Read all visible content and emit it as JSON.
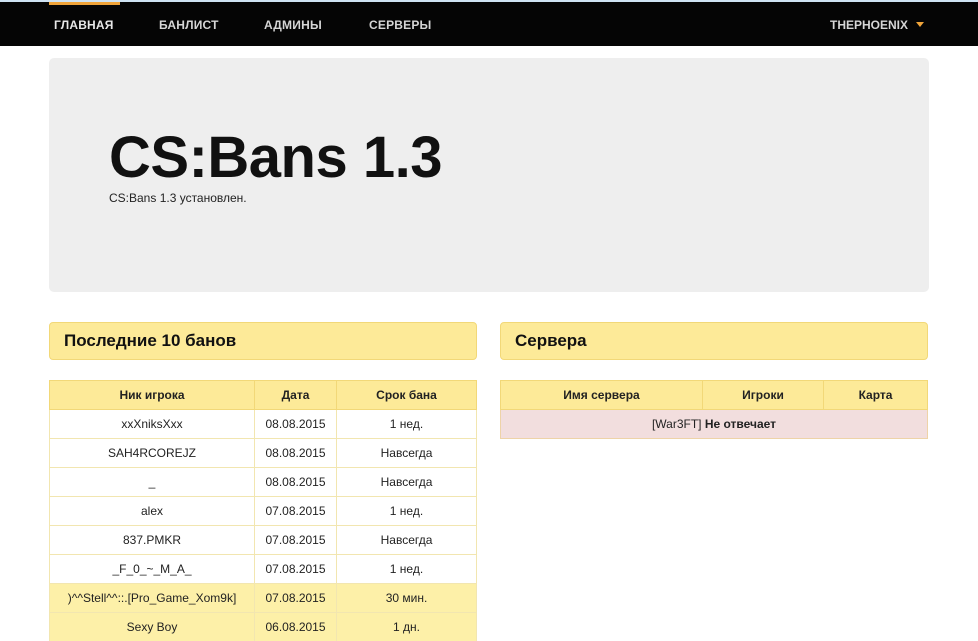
{
  "nav": {
    "items": [
      "ГЛАВНАЯ",
      "БАНЛИСТ",
      "АДМИНЫ",
      "СЕРВЕРЫ"
    ],
    "user": "THEPHOENIX"
  },
  "hero": {
    "title": "CS:Bans 1.3",
    "subtitle": "CS:Bans 1.3 установлен."
  },
  "bans": {
    "title": "Последние 10 банов",
    "columns": [
      "Ник игрока",
      "Дата",
      "Срок бана"
    ],
    "rows": [
      [
        "xxXniksXxx",
        "08.08.2015",
        "1 нед."
      ],
      [
        "SAH4RCOREJZ",
        "08.08.2015",
        "Навсегда"
      ],
      [
        "_",
        "08.08.2015",
        "Навсегда"
      ],
      [
        "alex",
        "07.08.2015",
        "1 нед."
      ],
      [
        "837.PMKR",
        "07.08.2015",
        "Навсегда"
      ],
      [
        "_F_0_~_M_A_",
        "07.08.2015",
        "1 нед."
      ],
      [
        ")^^Stell^^::.[Pro_Game_Xom9k]",
        "07.08.2015",
        "30 мин."
      ],
      [
        "Sexy Boy",
        "06.08.2015",
        "1 дн."
      ]
    ]
  },
  "servers": {
    "title": "Сервера",
    "columns": [
      "Имя сервера",
      "Игроки",
      "Карта"
    ],
    "row": {
      "name": "[War3FT]",
      "status": "Не отвечает"
    }
  },
  "colors": {
    "accent": "#f0a43a",
    "panel": "#fdea98",
    "navbar": "#050505"
  }
}
